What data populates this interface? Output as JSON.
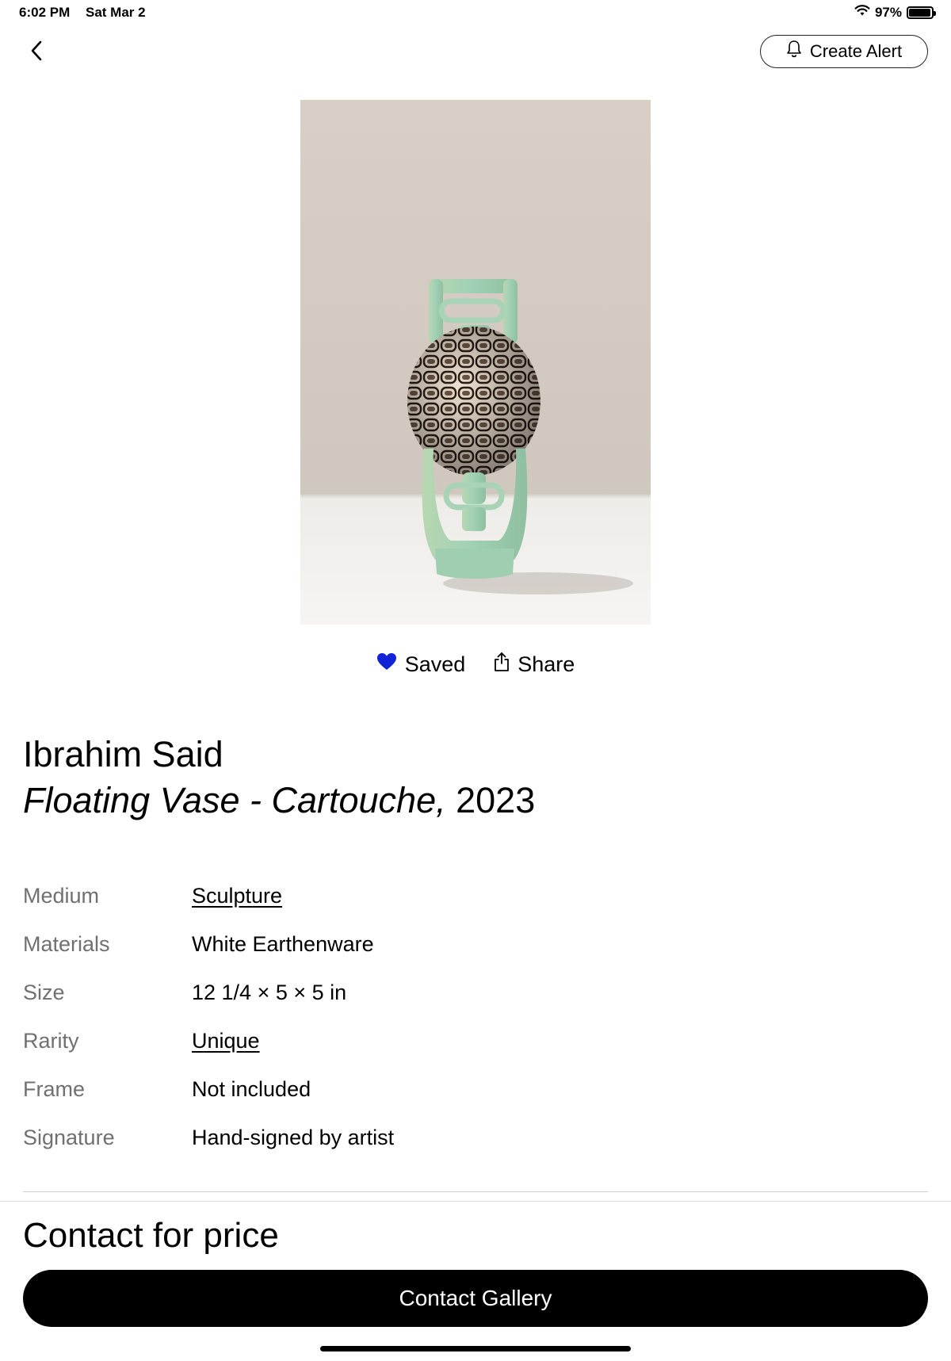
{
  "status_bar": {
    "time": "6:02 PM",
    "date": "Sat Mar 2",
    "battery": "97%",
    "battery_level": 0.97
  },
  "header": {
    "back_icon": "chevron-left-icon",
    "create_alert_label": "Create Alert",
    "create_alert_icon": "bell-icon"
  },
  "artwork": {
    "image_icon": "vase-artwork"
  },
  "actions": {
    "saved_label": "Saved",
    "saved_icon": "heart-icon",
    "saved_color": "#1023d7",
    "share_label": "Share",
    "share_icon": "share-icon"
  },
  "artist_name": "Ibrahim Said",
  "artwork_title": "Floating Vase - Cartouche,",
  "artwork_year": "2023",
  "details": [
    {
      "label": "Medium",
      "value": "Sculpture",
      "link": true
    },
    {
      "label": "Materials",
      "value": "White Earthenware",
      "link": false
    },
    {
      "label": "Size",
      "value": "12 1/4 × 5 × 5 in",
      "link": false
    },
    {
      "label": "Rarity",
      "value": "Unique",
      "link": true
    },
    {
      "label": "Frame",
      "value": "Not included",
      "link": false
    },
    {
      "label": "Signature",
      "value": "Hand-signed by artist",
      "link": false
    }
  ],
  "price_label": "Contact for price",
  "contact_button_label": "Contact Gallery"
}
